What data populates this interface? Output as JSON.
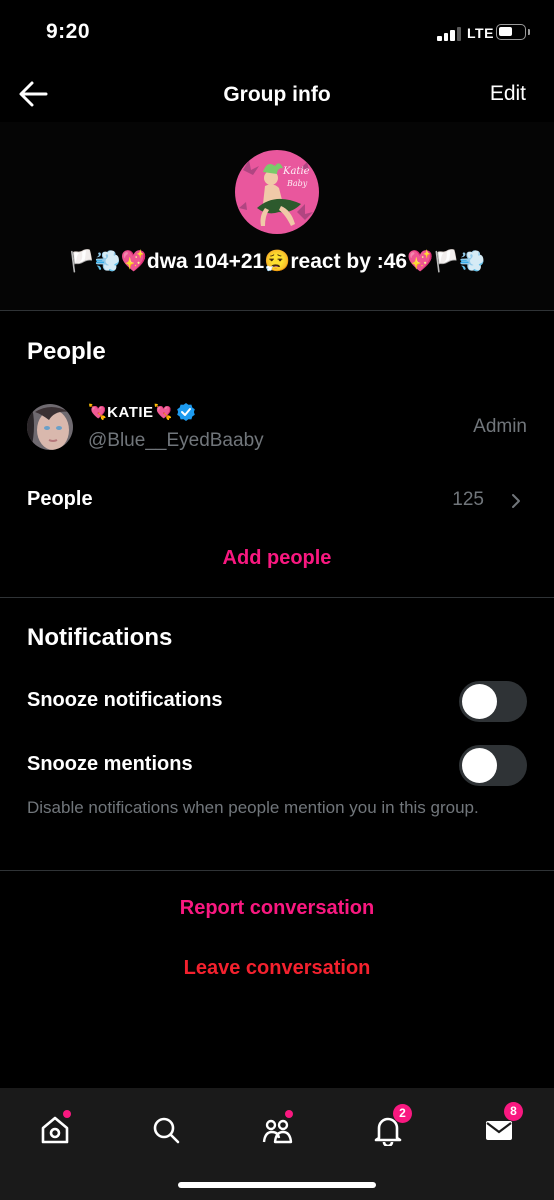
{
  "status_bar": {
    "time": "9:20",
    "network": "LTE",
    "signal_bars_active": 3,
    "signal_bars_total": 4,
    "battery_level": 0.55
  },
  "header": {
    "title": "Group info",
    "edit_label": "Edit",
    "back_icon": "arrow-left-icon"
  },
  "group": {
    "name": "🏳️💨💖dwa 104+21😮‍💨react by :46💖🏳️💨"
  },
  "people_section": {
    "title": "People",
    "admin": {
      "name": "💘KATIE💘",
      "handle": "@Blue__EyedBaaby",
      "role": "Admin",
      "verified_icon": "verified-badge-icon"
    },
    "people_row": {
      "label": "People",
      "count": "125"
    },
    "add_people_label": "Add people"
  },
  "notifications_section": {
    "title": "Notifications",
    "snooze_notifications": {
      "label": "Snooze notifications",
      "on": false
    },
    "snooze_mentions": {
      "label": "Snooze mentions",
      "on": false
    },
    "hint": "Disable notifications when people mention you in this group."
  },
  "actions": {
    "report_label": "Report conversation",
    "leave_label": "Leave conversation"
  },
  "bottom_nav": {
    "items": [
      {
        "icon": "home-icon",
        "dot": true
      },
      {
        "icon": "search-icon",
        "dot": false
      },
      {
        "icon": "communities-icon",
        "dot": true
      },
      {
        "icon": "bell-icon",
        "badge": "2"
      },
      {
        "icon": "mail-icon",
        "badge": "8"
      }
    ]
  },
  "colors": {
    "background": "#000000",
    "accent_pink": "#f91880",
    "danger_red": "#f4212e",
    "verified_blue": "#1d9bf0",
    "muted_text": "#71767b",
    "divider": "#2f3336"
  }
}
